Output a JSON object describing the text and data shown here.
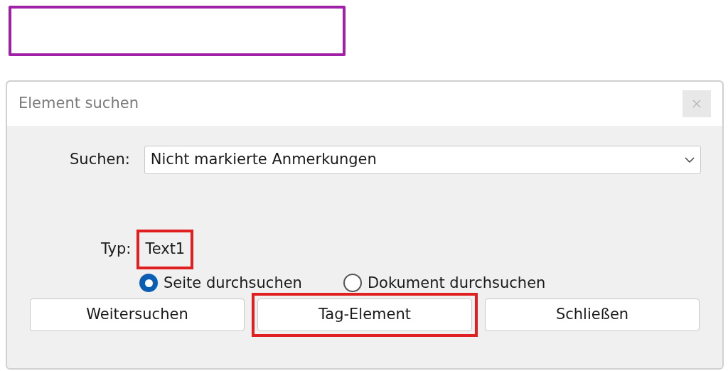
{
  "dialog": {
    "title": "Element suchen",
    "search": {
      "label": "Suchen:",
      "value": "Nicht markierte Anmerkungen"
    },
    "type": {
      "label": "Typ:",
      "value": "Text1",
      "highlighted": true
    },
    "scope": [
      {
        "label": "Seite durchsuchen",
        "selected": true
      },
      {
        "label": "Dokument durchsuchen",
        "selected": false
      }
    ],
    "buttons": [
      {
        "label": "Weitersuchen",
        "highlighted": false
      },
      {
        "label": "Tag-Element",
        "highlighted": true
      },
      {
        "label": "Schließen",
        "highlighted": false
      }
    ]
  }
}
